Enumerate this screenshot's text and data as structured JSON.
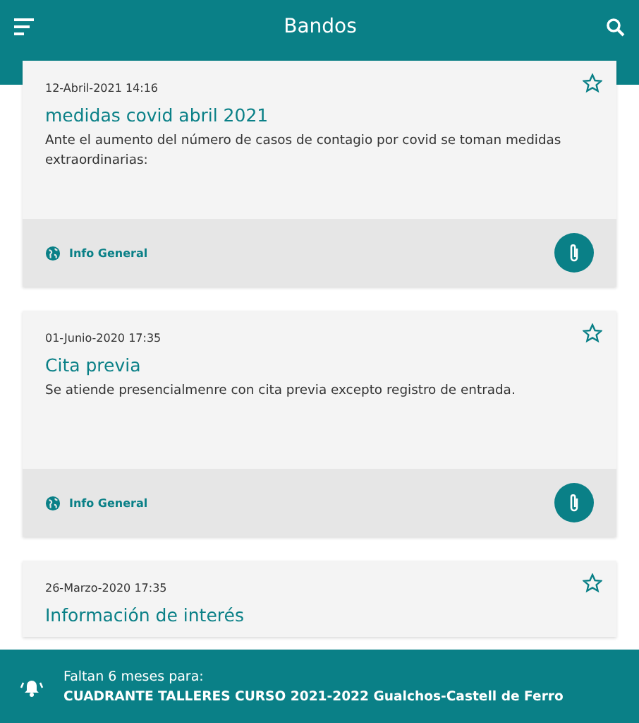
{
  "app_bar": {
    "title": "Bandos"
  },
  "bandos": [
    {
      "date": "12-Abril-2021 14:16",
      "title": "medidas covid abril 2021",
      "body": "Ante el aumento del número de casos de contagio por covid se toman medidas extraordinarias:",
      "favorite": false,
      "category": "Info General",
      "has_attachment": true
    },
    {
      "date": "01-Junio-2020 17:35",
      "title": "Cita previa",
      "body": "Se atiende presencialmenre con cita previa excepto registro de entrada.",
      "favorite": false,
      "category": "Info General",
      "has_attachment": true
    },
    {
      "date": "26-Marzo-2020 17:35",
      "title": "Información de interés",
      "favorite": false
    }
  ],
  "reminder": {
    "label": "Faltan 6 meses para:",
    "event": "CUADRANTE TALLERES CURSO 2021-2022 Gualchos-Castell de Ferro"
  }
}
